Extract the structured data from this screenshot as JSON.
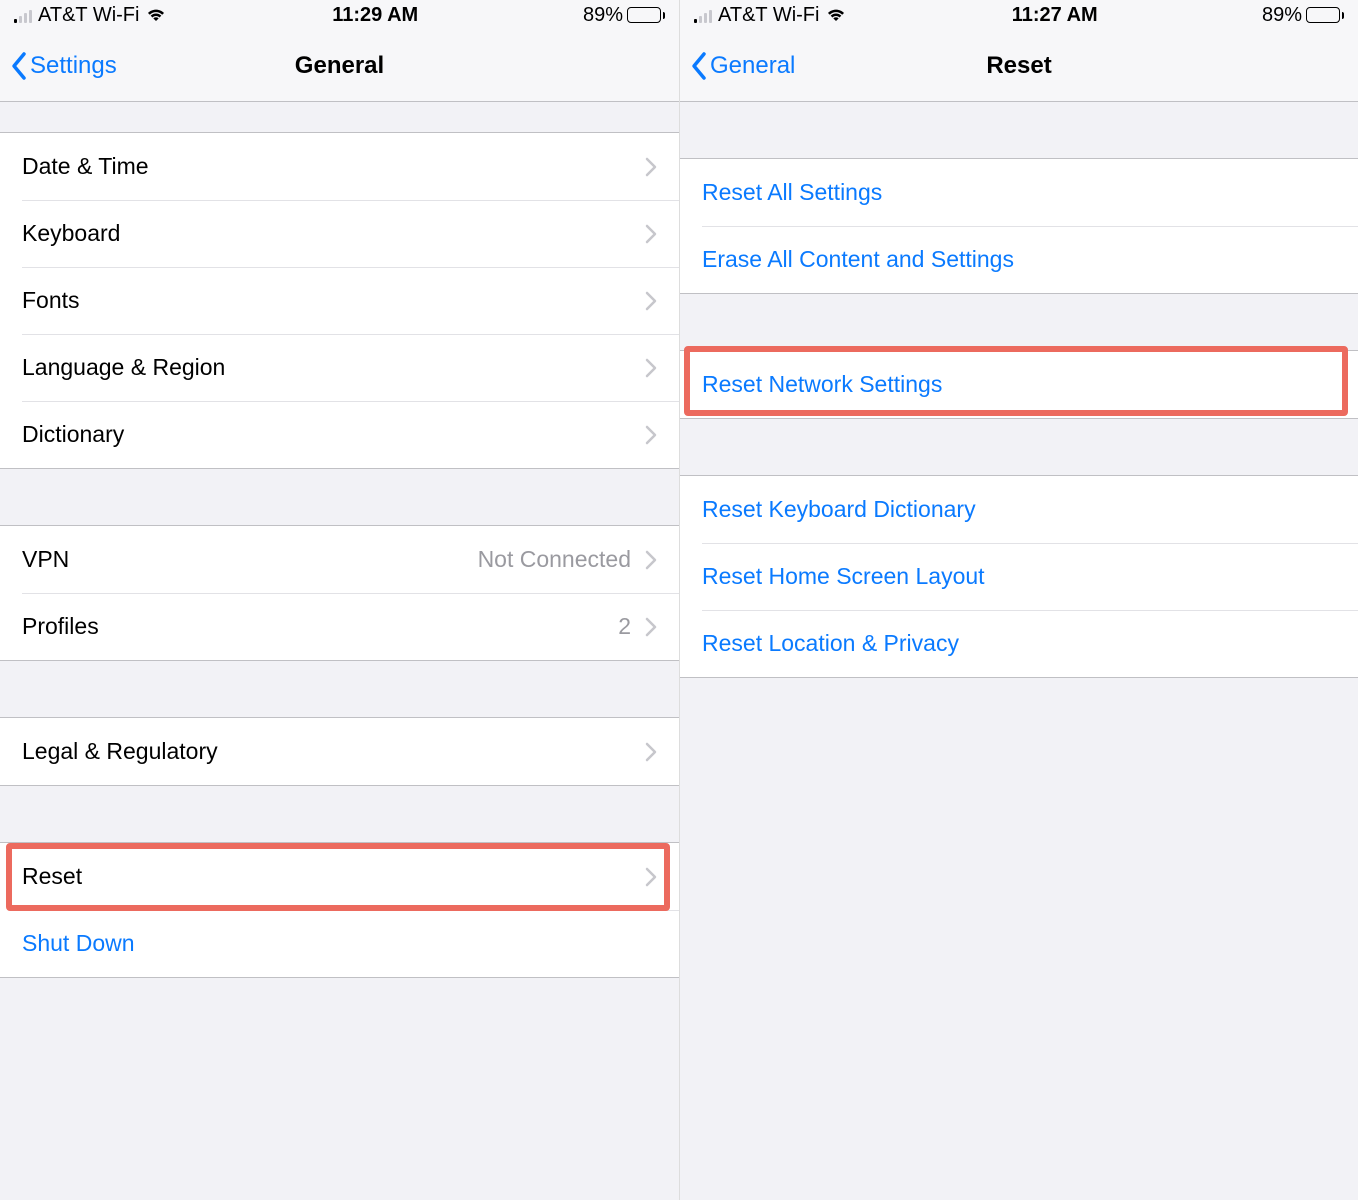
{
  "left": {
    "status": {
      "carrier": "AT&T Wi-Fi",
      "time": "11:29 AM",
      "battery_pct": "89%"
    },
    "nav": {
      "back": "Settings",
      "title": "General"
    },
    "group1": [
      {
        "label": "Date & Time"
      },
      {
        "label": "Keyboard"
      },
      {
        "label": "Fonts"
      },
      {
        "label": "Language & Region"
      },
      {
        "label": "Dictionary"
      }
    ],
    "group2": [
      {
        "label": "VPN",
        "value": "Not Connected"
      },
      {
        "label": "Profiles",
        "value": "2"
      }
    ],
    "group3": [
      {
        "label": "Legal & Regulatory"
      }
    ],
    "group4": [
      {
        "label": "Reset"
      },
      {
        "label": "Shut Down",
        "link": true,
        "no_chevron": true
      }
    ]
  },
  "right": {
    "status": {
      "carrier": "AT&T Wi-Fi",
      "time": "11:27 AM",
      "battery_pct": "89%"
    },
    "nav": {
      "back": "General",
      "title": "Reset"
    },
    "group1": [
      {
        "label": "Reset All Settings"
      },
      {
        "label": "Erase All Content and Settings"
      }
    ],
    "group2": [
      {
        "label": "Reset Network Settings"
      }
    ],
    "group3": [
      {
        "label": "Reset Keyboard Dictionary"
      },
      {
        "label": "Reset Home Screen Layout"
      },
      {
        "label": "Reset Location & Privacy"
      }
    ]
  }
}
